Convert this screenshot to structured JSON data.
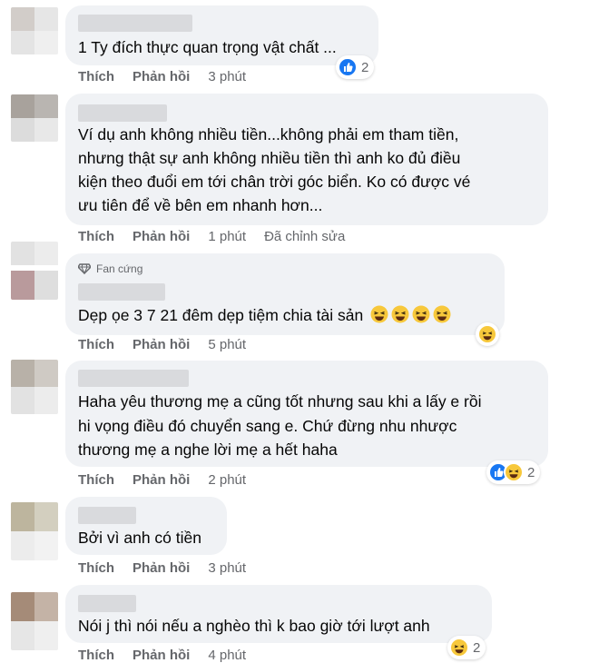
{
  "action_labels": {
    "like": "Thích",
    "reply": "Phản hồi"
  },
  "comments": [
    {
      "text_lines": [
        "1 Ty đích thực quan trọng vật chất ..."
      ],
      "time": "3 phút",
      "reaction_count": "2"
    },
    {
      "text_lines": [
        "Ví dụ anh không nhiều tiền...không phải em tham tiền,",
        "nhưng thật sự anh không nhiều tiền thì anh ko đủ điều",
        "kiện theo đuổi em tới chân trời góc biển. Ko có được vé",
        "ưu tiên để về bên em nhanh hơn..."
      ],
      "time": "1 phút",
      "edited": "Đã chỉnh sửa"
    },
    {
      "badge": "Fan cứng",
      "text_lines": [
        "Dẹp ọe 3 7 21 đêm dẹp tiệm chia tài sản"
      ],
      "time": "5 phút"
    },
    {
      "text_lines": [
        "Haha yêu thương mẹ a cũng tốt nhưng sau khi a lấy e rồi",
        "hi vọng điều đó chuyển sang e. Chứ đừng nhu nhược",
        "thương mẹ a nghe lời mẹ a hết haha"
      ],
      "time": "2 phút",
      "reaction_count": "2"
    },
    {
      "text_lines": [
        "Bởi vì anh có tiền"
      ],
      "time": "3 phút"
    },
    {
      "text_lines": [
        "Nói j thì nói nếu a nghèo thì k bao giờ tới lượt anh"
      ],
      "time": "4 phút",
      "reaction_count": "2"
    }
  ],
  "colors": {
    "bubble": "#f0f2f5",
    "meta": "#65676b",
    "like_blue": "#1877f2",
    "haha_yellow": "#f7c83b"
  },
  "icons": {
    "like": "thumbs-up-icon",
    "haha": "laughing-face-icon",
    "fan": "diamond-icon"
  }
}
